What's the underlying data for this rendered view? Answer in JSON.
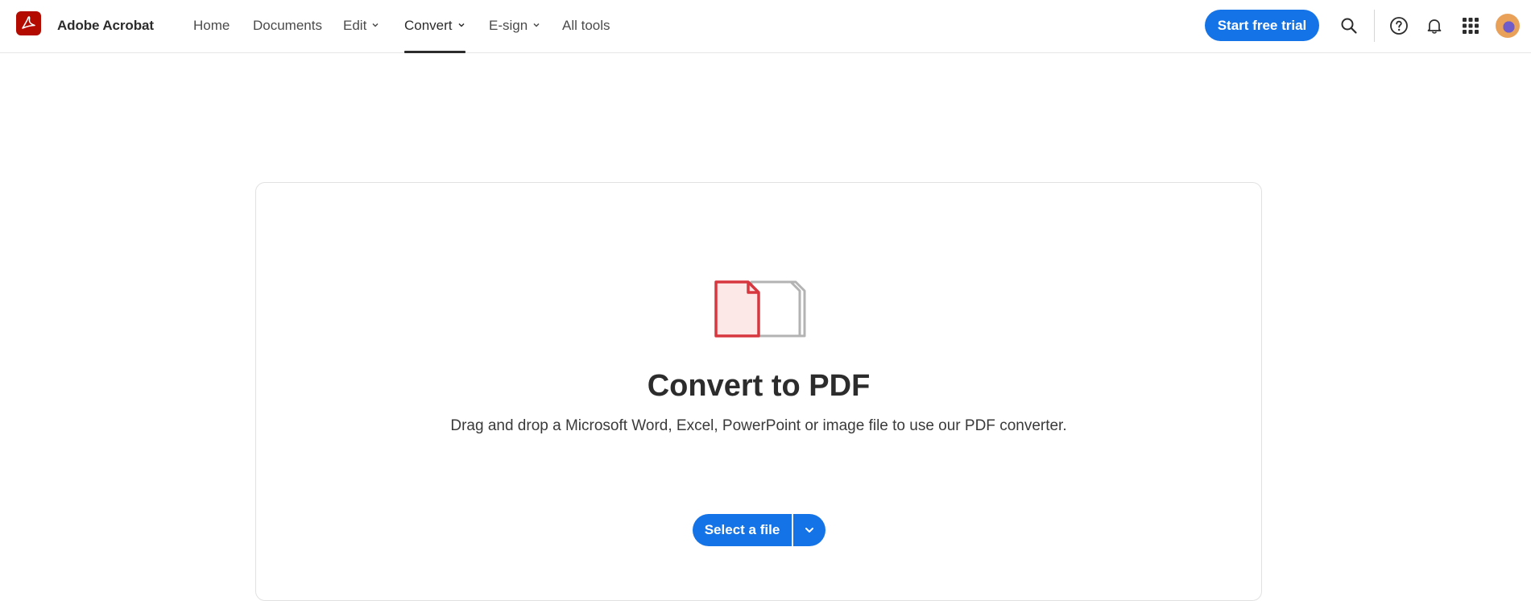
{
  "header": {
    "brand": "Adobe Acrobat",
    "nav": [
      {
        "label": "Home",
        "has_menu": false,
        "active": false
      },
      {
        "label": "Documents",
        "has_menu": false,
        "active": false
      },
      {
        "label": "Edit",
        "has_menu": true,
        "active": false
      },
      {
        "label": "Convert",
        "has_menu": true,
        "active": true
      },
      {
        "label": "E-sign",
        "has_menu": true,
        "active": false
      },
      {
        "label": "All tools",
        "has_menu": false,
        "active": false
      }
    ],
    "trial_button": "Start free trial",
    "icons": [
      "search-icon",
      "help-icon",
      "bell-icon",
      "app-grid-icon"
    ]
  },
  "main": {
    "title": "Convert to PDF",
    "subtitle": "Drag and drop a Microsoft Word, Excel, PowerPoint or image file to use our PDF converter.",
    "select_button": "Select a file"
  },
  "colors": {
    "accent": "#1473e6",
    "brand_red": "#b30b00",
    "file_red": "#d7373f"
  }
}
